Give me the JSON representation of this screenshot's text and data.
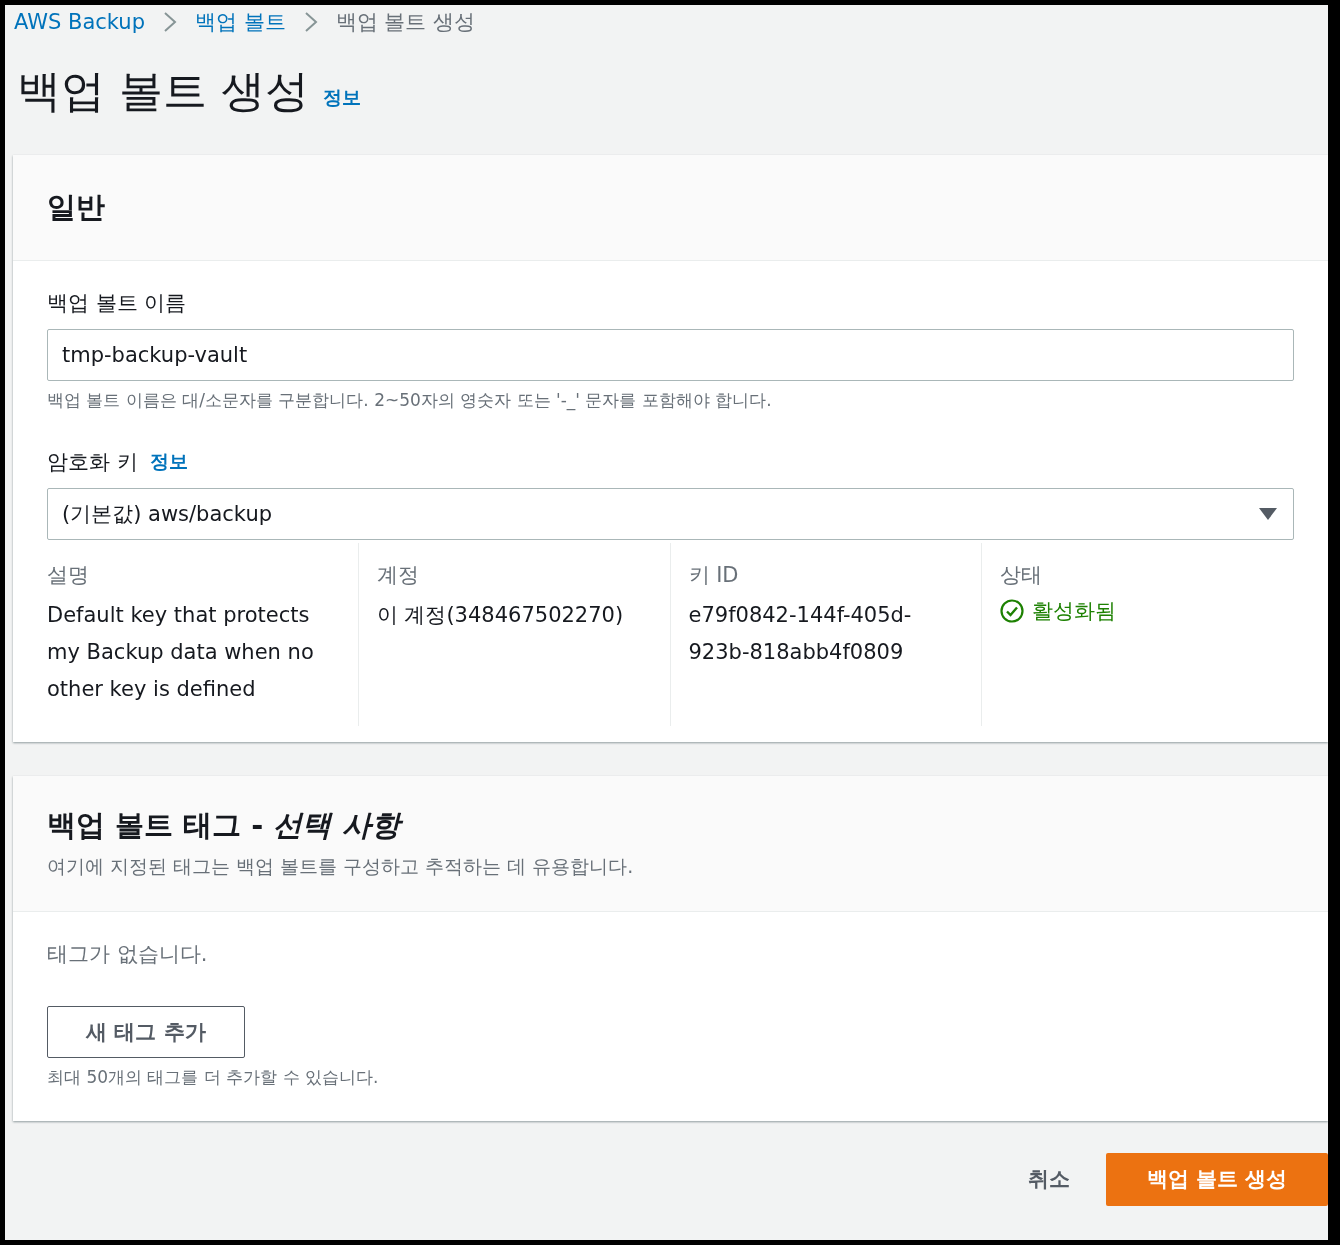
{
  "breadcrumb": [
    {
      "label": "AWS Backup",
      "link": true
    },
    {
      "label": "백업 볼트",
      "link": true
    },
    {
      "label": "백업 볼트 생성",
      "link": false
    }
  ],
  "page": {
    "title": "백업 볼트 생성",
    "info": "정보"
  },
  "general": {
    "title": "일반",
    "name_field": {
      "label": "백업 볼트 이름",
      "value": "tmp-backup-vault",
      "hint": "백업 볼트 이름은 대/소문자를 구분합니다. 2~50자의 영숫자 또는 '-_' 문자를 포함해야 합니다."
    },
    "key_field": {
      "label": "암호화 키",
      "info": "정보",
      "value": "(기본값) aws/backup"
    },
    "key_details": [
      {
        "label": "설명",
        "value": "Default key that protects my Backup data when no other key is defined",
        "kind": "text"
      },
      {
        "label": "계정",
        "value": "이 계정(348467502270)",
        "kind": "text"
      },
      {
        "label": "키 ID",
        "value": "e79f0842-144f-405d-923b-818abb4f0809",
        "kind": "text"
      },
      {
        "label": "상태",
        "value": "활성화됨",
        "kind": "status"
      }
    ]
  },
  "tags": {
    "title": "백업 볼트 태그 - ",
    "title_optional": "선택 사항",
    "description": "여기에 지정된 태그는 백업 볼트를 구성하고 추적하는 데 유용합니다.",
    "empty": "태그가 없습니다.",
    "add_button": "새 태그 추가",
    "limit": "최대 50개의 태그를 더 추가할 수 있습니다."
  },
  "footer": {
    "cancel": "취소",
    "submit": "백업 볼트 생성"
  }
}
